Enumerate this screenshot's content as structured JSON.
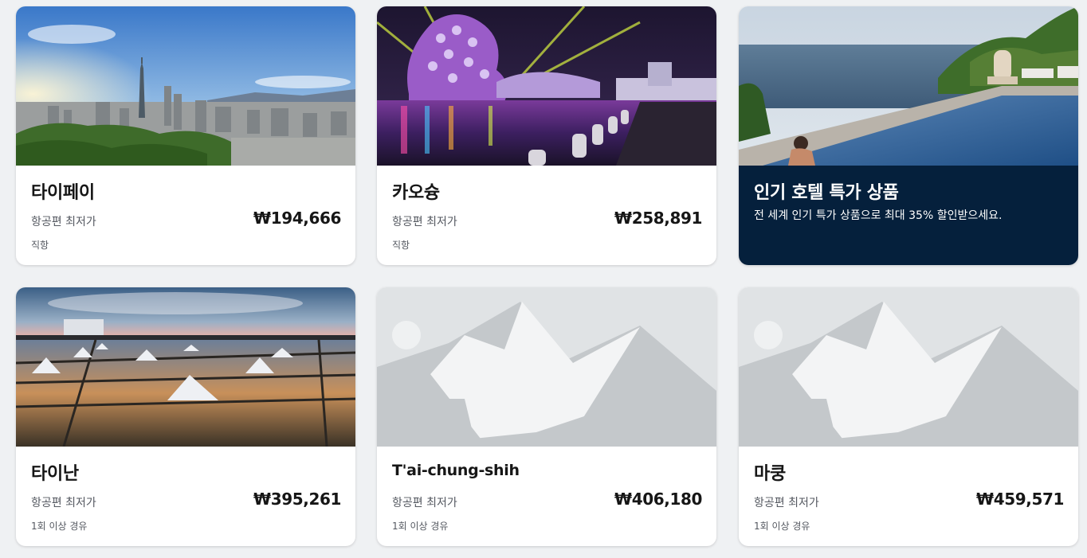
{
  "cards": [
    {
      "name": "타이페이",
      "label": "항공편 최저가",
      "price": "₩194,666",
      "stop": "직항",
      "image": "taipei-skyline-photo"
    },
    {
      "name": "카오슝",
      "label": "항공편 최저가",
      "price": "₩258,891",
      "stop": "직항",
      "image": "kaohsiung-night-harbor-photo"
    },
    {
      "name": "타이난",
      "label": "항공편 최저가",
      "price": "₩395,261",
      "stop": "1회 이상 경유",
      "image": "tainan-salt-field-photo"
    },
    {
      "name": "T'ai-chung-shih",
      "label": "항공편 최저가",
      "price": "₩406,180",
      "stop": "1회 이상 경유",
      "image": "mountain-placeholder-icon"
    },
    {
      "name": "마쿵",
      "label": "항공편 최저가",
      "price": "₩459,571",
      "stop": "1회 이상 경유",
      "image": "mountain-placeholder-icon"
    }
  ],
  "promo": {
    "title": "인기 호텔 특가 상품",
    "text": "전 세계 인기 특가 상품으로 최대 35% 할인받으세요.",
    "image": "infinity-pool-photo"
  },
  "colors": {
    "page_bg": "#eff1f3",
    "promo_bg": "#05203c",
    "text_primary": "#161616",
    "text_secondary": "#545860"
  }
}
